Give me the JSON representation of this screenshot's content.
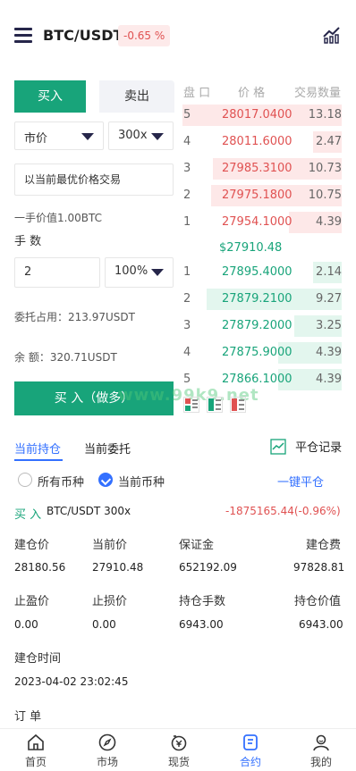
{
  "header": {
    "pair": "BTC/USDT",
    "change": "-0.65 %"
  },
  "trade": {
    "buy_tab": "买入",
    "sell_tab": "卖出",
    "order_type": "市价",
    "leverage": "300x",
    "price_input": "以当前最优价格交易",
    "lot_value": "一手价值1.00BTC",
    "qty_label": "手 数",
    "qty_value": "2",
    "percent": "100%",
    "margin_used": "委托占用：213.97USDT",
    "balance": "余 额：320.71USDT",
    "buy_button": "买 入（做多）"
  },
  "orderbook": {
    "headers": {
      "level": "盘 口",
      "price": "价 格",
      "qty": "交易数量"
    },
    "asks": [
      {
        "idx": "5",
        "price": "28017.0400",
        "qty": "13.18",
        "depth": 1.0
      },
      {
        "idx": "4",
        "price": "28011.6000",
        "qty": "2.47",
        "depth": 0.18
      },
      {
        "idx": "3",
        "price": "27985.3100",
        "qty": "10.73",
        "depth": 0.81
      },
      {
        "idx": "2",
        "price": "27975.1800",
        "qty": "10.75",
        "depth": 0.82
      },
      {
        "idx": "1",
        "price": "27954.1000",
        "qty": "4.39",
        "depth": 0.33
      }
    ],
    "mid_price": "$27910.48",
    "bids": [
      {
        "idx": "1",
        "price": "27895.4000",
        "qty": "2.14",
        "depth": 0.18
      },
      {
        "idx": "2",
        "price": "27879.2100",
        "qty": "9.27",
        "depth": 0.85
      },
      {
        "idx": "3",
        "price": "27879.2000",
        "qty": "3.25",
        "depth": 0.3
      },
      {
        "idx": "4",
        "price": "27875.9000",
        "qty": "4.39",
        "depth": 0.4
      },
      {
        "idx": "5",
        "price": "27866.1000",
        "qty": "4.39",
        "depth": 0.4
      }
    ],
    "watermark": "www.99k9.net"
  },
  "positions": {
    "tab_current": "当前持仓",
    "tab_orders": "当前委托",
    "close_record": "平仓记录",
    "all_pairs": "所有币种",
    "current_pair": "当前币种",
    "close_all": "一键平仓",
    "position": {
      "side": "买 入",
      "pair": "BTC/USDT 300x",
      "pnl": "-1875165.44(-0.96%)",
      "labels1": [
        "建仓价",
        "当前价",
        "保证金",
        "建仓费"
      ],
      "values1": [
        "28180.56",
        "27910.48",
        "652192.09",
        "97828.81"
      ],
      "labels2": [
        "止盈价",
        "止损价",
        "持仓手数",
        "持仓价值"
      ],
      "values2": [
        "0.00",
        "0.00",
        "6943.00",
        "6943.00"
      ],
      "open_time_label": "建仓时间",
      "open_time": "2023-04-02 23:02:45",
      "order_label": "订 单"
    }
  },
  "nav": [
    "首页",
    "市场",
    "现货",
    "合约",
    "我的"
  ]
}
